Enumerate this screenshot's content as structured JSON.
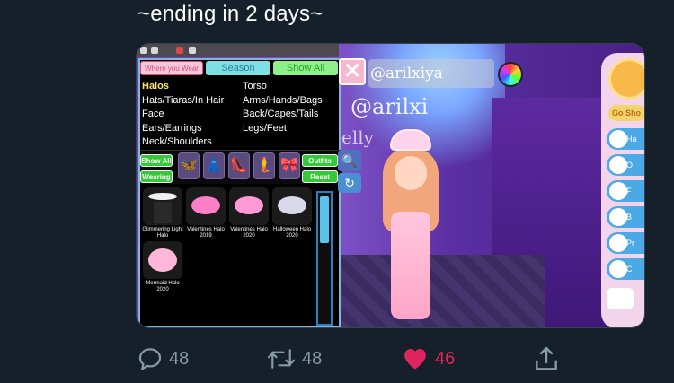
{
  "tweet": {
    "text": "~ending in 2 days~"
  },
  "game": {
    "tabs": [
      "Where you Wear",
      "Season",
      "Show All"
    ],
    "categories_left": [
      "Halos",
      "Hats/Tiaras/In Hair",
      "Face",
      "Ears/Earrings",
      "Neck/Shoulders"
    ],
    "categories_right": [
      "Torso",
      "Arms/Hands/Bags",
      "Back/Capes/Tails",
      "Legs/Feet"
    ],
    "buttons": {
      "show_all": "Show All",
      "wearing": "Wearing",
      "outfits": "Outfits",
      "reset": "Reset"
    },
    "items": [
      {
        "name": "Glimmering Light Halo",
        "color": "#f0f0f0"
      },
      {
        "name": "Valentines Halo 2019",
        "color": "#ff7ec8"
      },
      {
        "name": "Valentines Halo 2020",
        "color": "#ff9ad6"
      },
      {
        "name": "Halloween Halo 2020",
        "color": "#d8d8e8"
      },
      {
        "name": "Mermaid Halo 2020",
        "color": "#ffb6d9"
      }
    ],
    "username_field": "@arilxiya",
    "handle_overlay": "@arilxi",
    "handle_sub": "elly",
    "close_glyph": "✕",
    "right_menu": {
      "go_shop": "Go Sho",
      "buttons": [
        "Ha",
        "O",
        "F",
        "B",
        "Pr",
        "C"
      ]
    }
  },
  "actions": {
    "replies": "48",
    "retweets": "48",
    "likes": "46",
    "like_color": "#e0245e",
    "icon_color": "#8899a6"
  }
}
